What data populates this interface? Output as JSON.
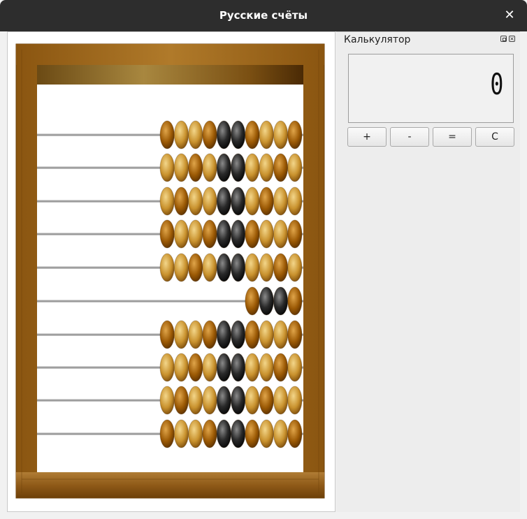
{
  "window": {
    "title": "Русские счёты",
    "close_glyph": "✕"
  },
  "calculator": {
    "title": "Калькулятор",
    "display": "0",
    "buttons": [
      "+",
      "-",
      "=",
      "C"
    ]
  },
  "abacus": {
    "rods": [
      {
        "beads": 10,
        "position": "right"
      },
      {
        "beads": 10,
        "position": "right"
      },
      {
        "beads": 10,
        "position": "right"
      },
      {
        "beads": 10,
        "position": "right"
      },
      {
        "beads": 10,
        "position": "right"
      },
      {
        "beads": 4,
        "position": "right"
      },
      {
        "beads": 10,
        "position": "right"
      },
      {
        "beads": 10,
        "position": "right"
      },
      {
        "beads": 10,
        "position": "right"
      },
      {
        "beads": 10,
        "position": "right"
      }
    ],
    "colors": {
      "frame": "#9b5f1a",
      "bead_light": "#c9922e",
      "bead_dark": "#9c5a05",
      "bead_black": "#1e1e1e"
    }
  }
}
